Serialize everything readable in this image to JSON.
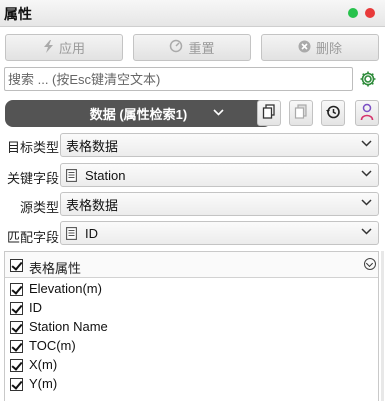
{
  "panel": {
    "title": "属性"
  },
  "toolbar": {
    "apply_label": "应用",
    "reset_label": "重置",
    "delete_label": "删除"
  },
  "search": {
    "placeholder": "搜索 ... (按Esc键清空文本)"
  },
  "datasource": {
    "label": "数据 (属性检索1)"
  },
  "fields": [
    {
      "label": "目标类型",
      "value": "表格数据",
      "icon": ""
    },
    {
      "label": "关键字段",
      "value": "Station",
      "icon": "table-icon"
    },
    {
      "label": "源类型",
      "value": "表格数据",
      "icon": ""
    },
    {
      "label": "匹配字段",
      "value": "ID",
      "icon": "table-icon"
    }
  ],
  "attributes": {
    "header": "表格属性",
    "items": [
      "Elevation(m)",
      "ID",
      "Station Name",
      "TOC(m)",
      "X(m)",
      "Y(m)"
    ]
  },
  "colors": {
    "accent_green": "#27c24c",
    "close_red": "#e83a3a",
    "datasource_bg": "#545454"
  }
}
